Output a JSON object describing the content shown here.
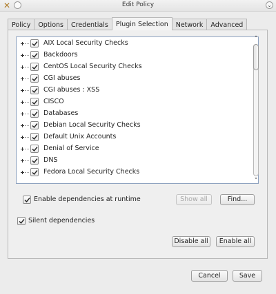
{
  "window": {
    "title": "Edit Policy"
  },
  "tabs": [
    {
      "label": "Policy"
    },
    {
      "label": "Options"
    },
    {
      "label": "Credentials"
    },
    {
      "label": "Plugin Selection",
      "active": true
    },
    {
      "label": "Network"
    },
    {
      "label": "Advanced"
    }
  ],
  "plugin_families": [
    {
      "label": "AIX Local Security Checks",
      "checked": true
    },
    {
      "label": "Backdoors",
      "checked": true
    },
    {
      "label": "CentOS Local Security Checks",
      "checked": true
    },
    {
      "label": "CGI abuses",
      "checked": true
    },
    {
      "label": "CGI abuses : XSS",
      "checked": true
    },
    {
      "label": "CISCO",
      "checked": true
    },
    {
      "label": "Databases",
      "checked": true
    },
    {
      "label": "Debian Local Security Checks",
      "checked": true
    },
    {
      "label": "Default Unix Accounts",
      "checked": true
    },
    {
      "label": "Denial of Service",
      "checked": true
    },
    {
      "label": "DNS",
      "checked": true
    },
    {
      "label": "Fedora Local Security Checks",
      "checked": true
    }
  ],
  "options": {
    "enable_dependencies_label": "Enable dependencies at runtime",
    "enable_dependencies_checked": true,
    "silent_dependencies_label": "Silent dependencies",
    "silent_dependencies_checked": true
  },
  "buttons": {
    "show_all": "Show all",
    "find": "Find...",
    "disable_all": "Disable all",
    "enable_all": "Enable all",
    "cancel": "Cancel",
    "save": "Save"
  },
  "icons": {
    "app": "tools-icon",
    "minimize": "minimize-icon",
    "close": "close-icon",
    "checkmark": "checkmark-icon"
  }
}
